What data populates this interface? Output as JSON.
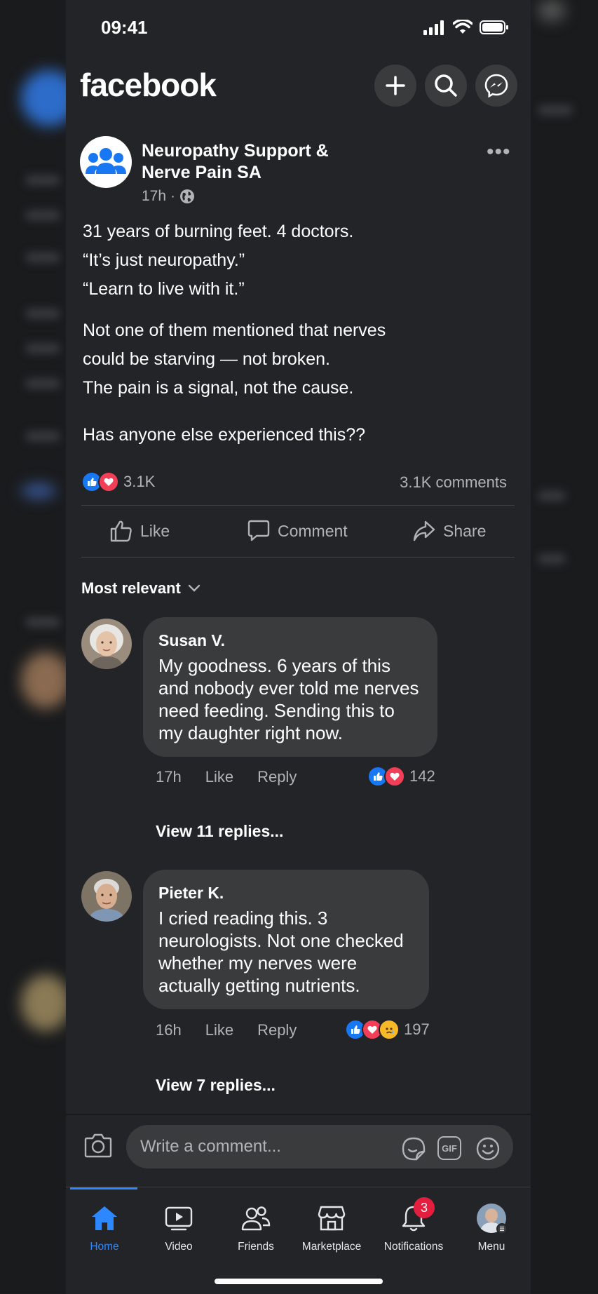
{
  "status_bar": {
    "time": "09:41"
  },
  "header": {
    "logo": "facebook"
  },
  "post": {
    "group_name": "Neuropathy Support & Nerve Pain SA",
    "time": "17h",
    "body": [
      [
        "31 years of burning feet. 4 doctors.",
        "“It’s just neuropathy.”",
        "“Learn to live with it.”"
      ],
      [
        "Not one of them mentioned that nerves",
        "could be starving — not broken.",
        "The pain is a signal, not the cause."
      ],
      [
        "Has anyone else experienced this??"
      ]
    ],
    "reaction_count": "3.1K",
    "comment_count": "3.1K comments",
    "actions": {
      "like": "Like",
      "comment": "Comment",
      "share": "Share"
    }
  },
  "comments_sort": "Most relevant",
  "comments": [
    {
      "author": "Susan V.",
      "text": "My goodness. 6 years of this and nobody ever told me nerves need feeding. Sending this to my daughter right now.",
      "time": "17h",
      "like": "Like",
      "reply": "Reply",
      "reaction_count": "142",
      "view_replies": "View 11 replies..."
    },
    {
      "author": "Pieter K.",
      "text": "I cried reading this. 3 neurologists. Not one checked whether my nerves were actually getting nutrients.",
      "time": "16h",
      "like": "Like",
      "reply": "Reply",
      "reaction_count": "197",
      "view_replies": "View 7 replies..."
    }
  ],
  "composer": {
    "placeholder": "Write a comment...",
    "gif": "GIF"
  },
  "tabs": {
    "home": "Home",
    "video": "Video",
    "friends": "Friends",
    "marketplace": "Marketplace",
    "notifications": "Notifications",
    "menu": "Menu"
  },
  "notifications_badge": "3",
  "colors": {
    "accent": "#2d88ff",
    "like_blue": "#1877f2",
    "love_red": "#f33e58",
    "badge_red": "#e41e3f"
  }
}
